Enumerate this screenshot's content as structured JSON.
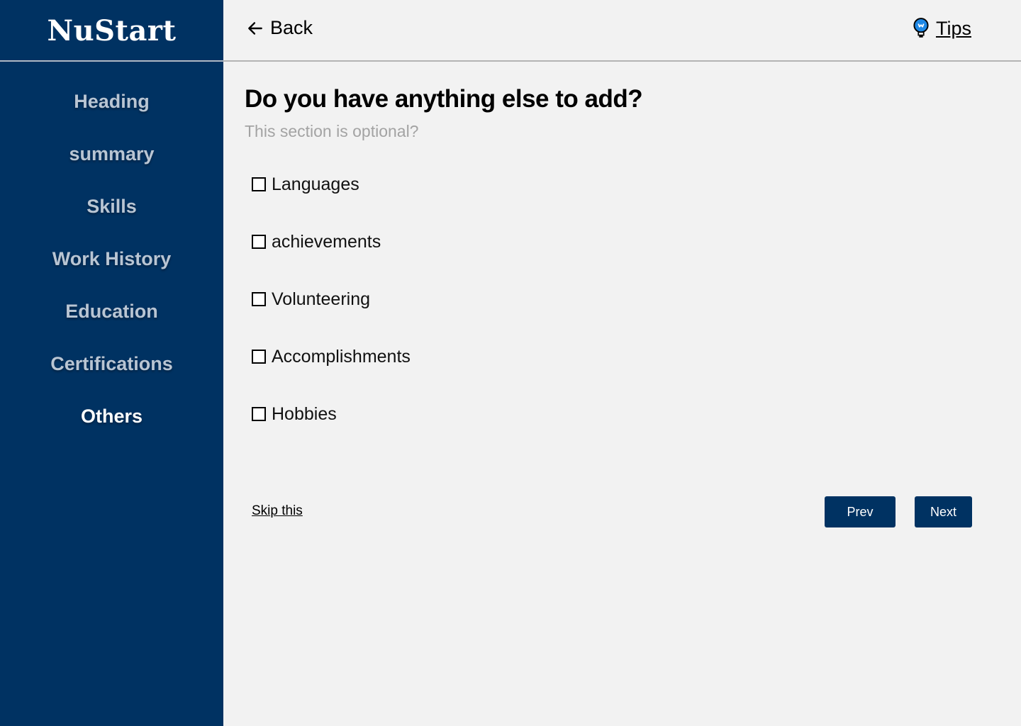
{
  "brand": {
    "logo": "NuStart"
  },
  "sidebar": {
    "items": [
      {
        "label": "Heading",
        "active": false
      },
      {
        "label": "summary",
        "active": false
      },
      {
        "label": "Skills",
        "active": false
      },
      {
        "label": "Work History",
        "active": false
      },
      {
        "label": "Education",
        "active": false
      },
      {
        "label": "Certifications",
        "active": false
      },
      {
        "label": "Others",
        "active": true
      }
    ]
  },
  "topbar": {
    "back_label": "Back",
    "tips_label": "Tips"
  },
  "main": {
    "title": "Do you have anything else to add?",
    "subtitle": "This section is optional?",
    "options": [
      {
        "label": "Languages",
        "checked": false
      },
      {
        "label": "achievements",
        "checked": false
      },
      {
        "label": "Volunteering",
        "checked": false
      },
      {
        "label": "Accomplishments",
        "checked": false
      },
      {
        "label": "Hobbies",
        "checked": false
      }
    ]
  },
  "footer": {
    "skip_label": "Skip this",
    "prev_label": "Prev",
    "next_label": "Next"
  },
  "colors": {
    "sidebar_bg": "#003262",
    "page_bg": "#f2f2f2",
    "button_bg": "#003262",
    "subtitle_text": "#a3a3a3",
    "tips_icon": "#1e88e5"
  }
}
